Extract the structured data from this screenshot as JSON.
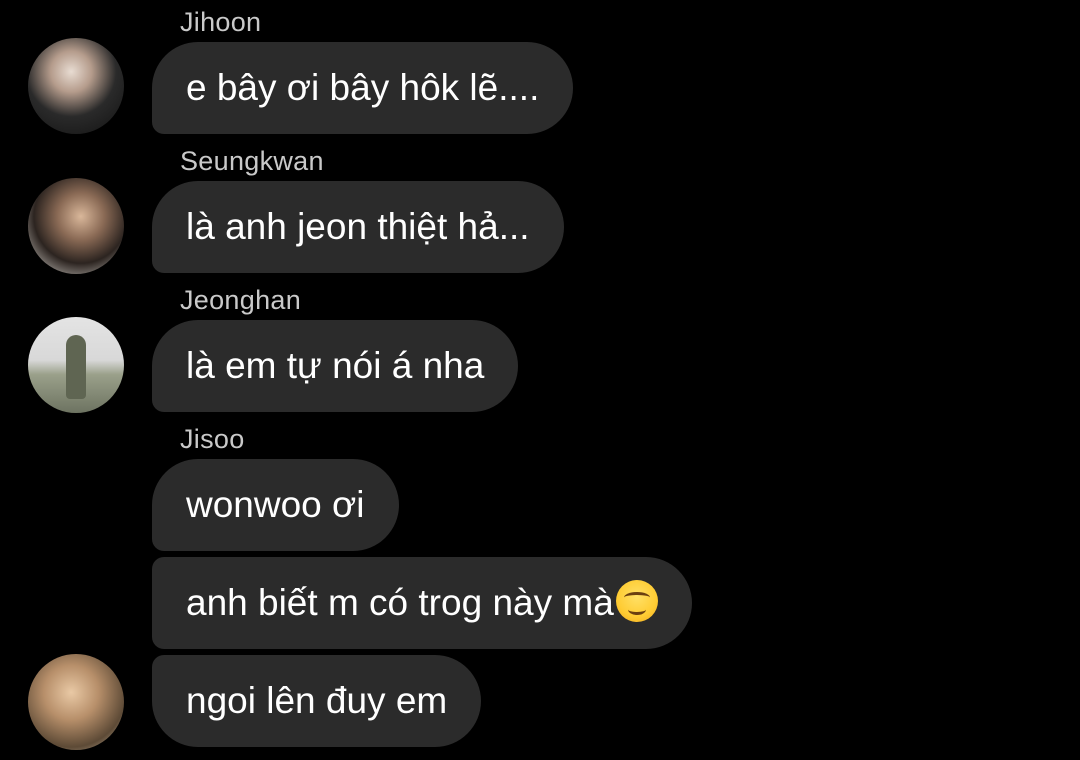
{
  "messages": [
    {
      "sender": "Jihoon",
      "texts": [
        "e bây ơi bây hôk lẽ...."
      ]
    },
    {
      "sender": "Seungkwan",
      "texts": [
        "là anh jeon thiệt hả..."
      ]
    },
    {
      "sender": "Jeonghan",
      "texts": [
        "là em tự nói á nha"
      ]
    },
    {
      "sender": "Jisoo",
      "texts": [
        "wonwoo ơi",
        "anh biết m có trog này mà",
        "ngoi lên đuy em"
      ]
    }
  ],
  "emoji": {
    "name": "smiling-face-icon"
  }
}
